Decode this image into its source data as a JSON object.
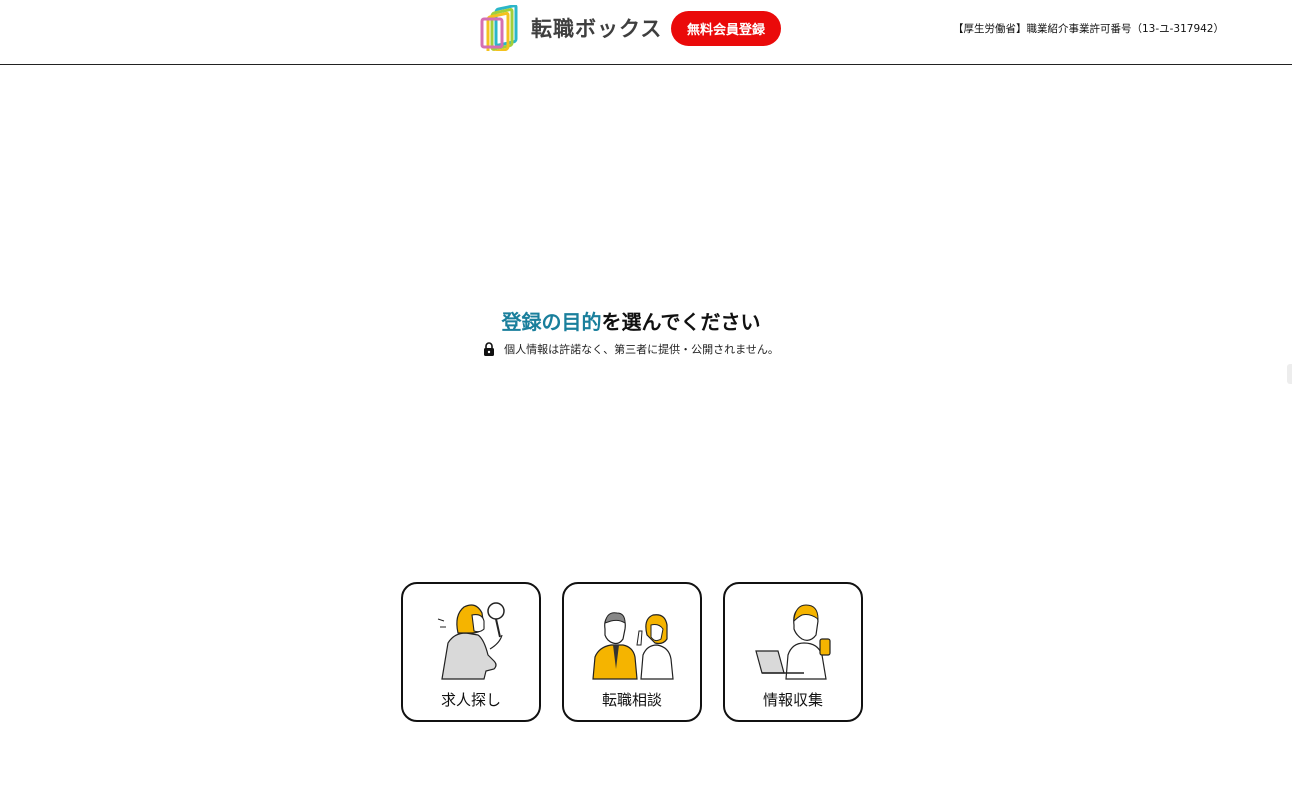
{
  "header": {
    "brand_name": "転職ボックス",
    "register_button": "無料会員登録",
    "license_text": "【厚生労働省】職業紹介事業許可番号（13-ユ-317942）"
  },
  "main": {
    "heading_accent": "登録の目的",
    "heading_rest": "を選んでください",
    "privacy_note": "個人情報は許諾なく、第三者に提供・公開されません。",
    "options": [
      {
        "label": "求人探し",
        "icon": "magnifier-person-illustration"
      },
      {
        "label": "転職相談",
        "icon": "consultation-illustration"
      },
      {
        "label": "情報収集",
        "icon": "laptop-person-illustration"
      }
    ]
  },
  "colors": {
    "accent": "#1a7f9c",
    "cta": "#ea0a0a",
    "illustration_yellow": "#f5b400"
  }
}
